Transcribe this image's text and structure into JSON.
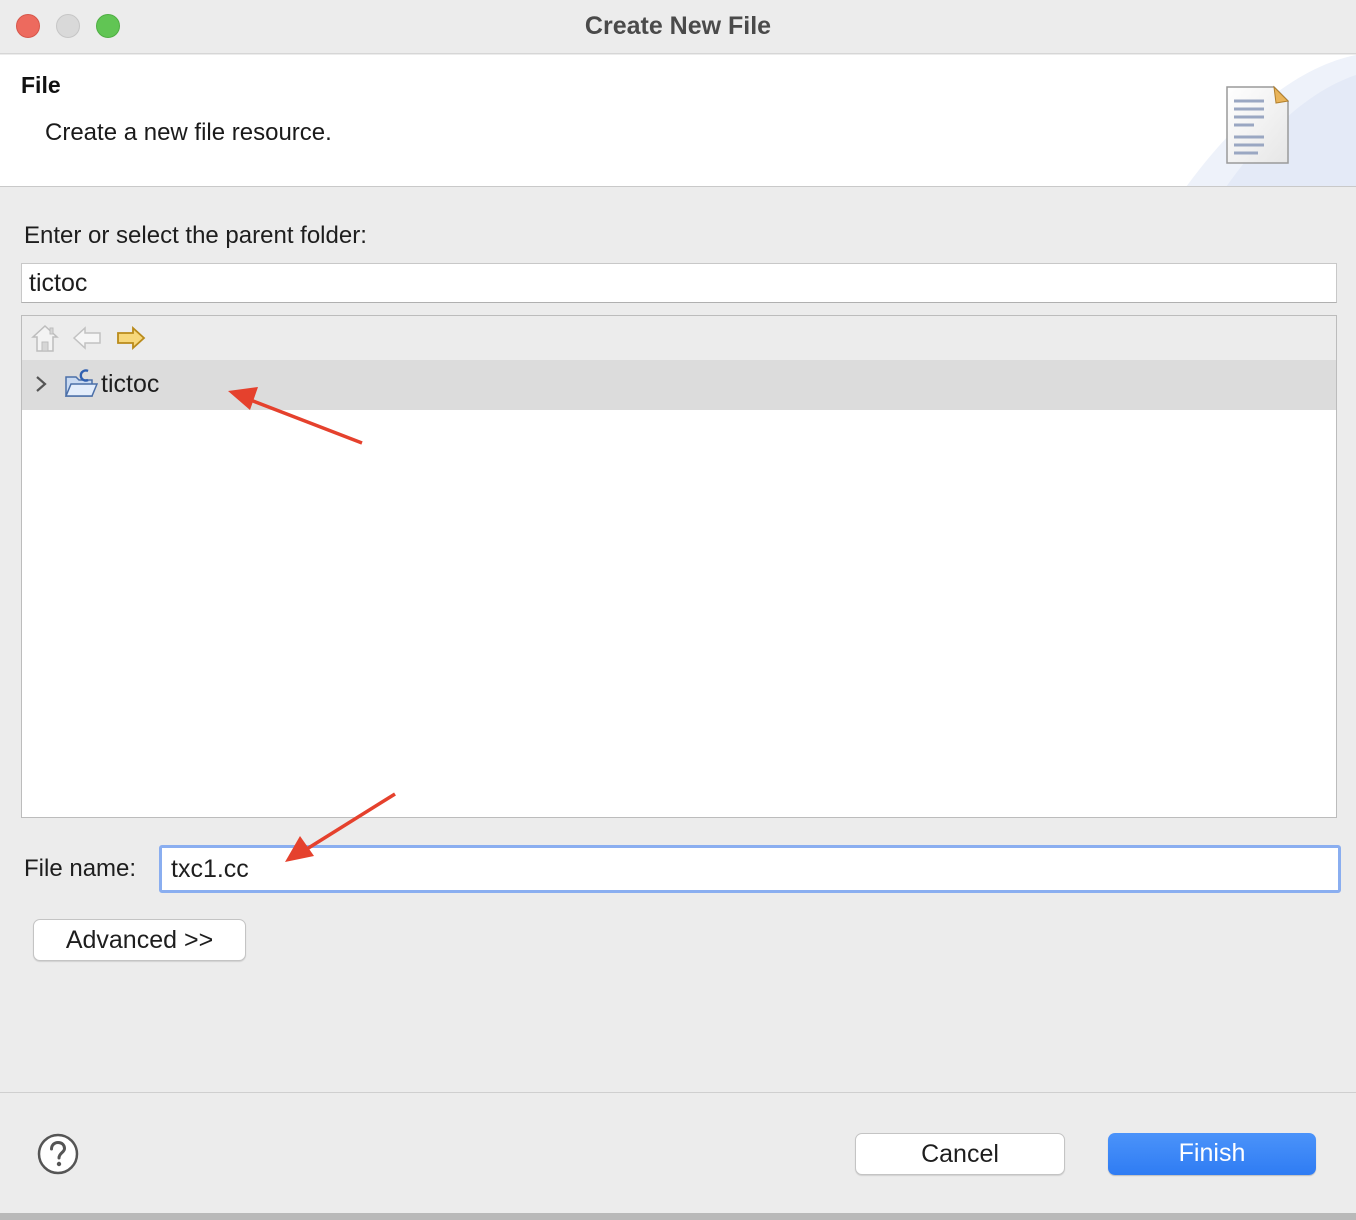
{
  "window": {
    "title": "Create New File"
  },
  "banner": {
    "title": "File",
    "description": "Create a new file resource."
  },
  "parent_folder": {
    "label": "Enter or select the parent folder:",
    "value": "tictoc"
  },
  "tree": {
    "toolbar": [
      "home-icon",
      "back-arrow-icon",
      "forward-arrow-icon"
    ],
    "items": [
      {
        "label": "tictoc",
        "expanded": false,
        "selected": true
      }
    ]
  },
  "file_name": {
    "label": "File name:",
    "value": "txc1.cc"
  },
  "buttons": {
    "advanced": "Advanced >>",
    "cancel": "Cancel",
    "finish": "Finish"
  },
  "colors": {
    "accent": "#3b86f7",
    "focus_ring": "#8aaef0",
    "annotation_arrow": "#e5412d",
    "selection_row": "#dcdcdc"
  }
}
